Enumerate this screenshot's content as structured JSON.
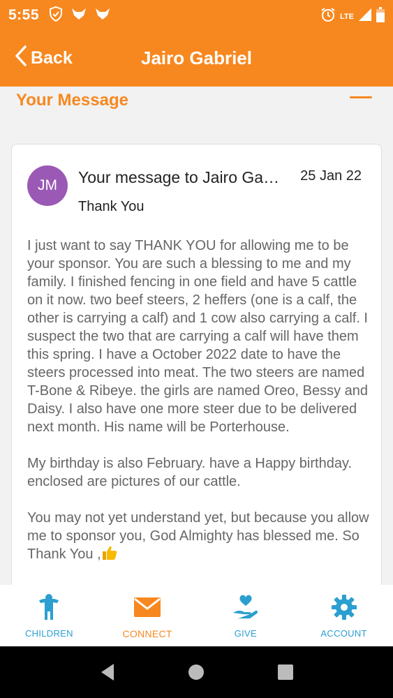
{
  "status_bar": {
    "time": "5:55",
    "network": "LTE",
    "icons": [
      "shield-icon",
      "fox-icon",
      "fox-icon",
      "alarm-icon",
      "signal-icon",
      "battery-icon"
    ]
  },
  "app_bar": {
    "back_label": "Back",
    "title": "Jairo Gabriel"
  },
  "section": {
    "label": "Your Message"
  },
  "message": {
    "avatar_initials": "JM",
    "subject": "Your message to Jairo Gabriel",
    "date": "25 Jan 22",
    "title": "Thank You",
    "paragraphs": [
      "I just want to say THANK YOU for allowing me to be your sponsor. You are such a blessing to me and my family. I finished fencing in one field and have 5 cattle on it now. two beef steers, 2 heffers (one is a calf, the other is carrying a calf) and 1 cow also carrying a calf. I suspect the two that are carrying a calf will have them this spring. I have a October 2022 date to have the steers processed into meat. The two steers are named T-Bone & Ribeye. the girls are named Oreo, Bessy and Daisy. I also have one more steer due to be delivered next month. His name will be Porterhouse.",
      "My birthday is also February. have a Happy birthday. enclosed are pictures of our cattle.",
      "You may not yet understand yet, but because you allow me to sponsor you, God Almighty has blessed me. So Thank You ,"
    ]
  },
  "tabs": [
    {
      "label": "CHILDREN",
      "icon": "child-icon"
    },
    {
      "label": "CONNECT",
      "icon": "envelope-icon"
    },
    {
      "label": "GIVE",
      "icon": "give-hand-icon"
    },
    {
      "label": "ACCOUNT",
      "icon": "gear-icon"
    }
  ],
  "colors": {
    "brand": "#f7881f",
    "tab_inactive": "#2a9fd0",
    "avatar": "#9b59b6"
  }
}
